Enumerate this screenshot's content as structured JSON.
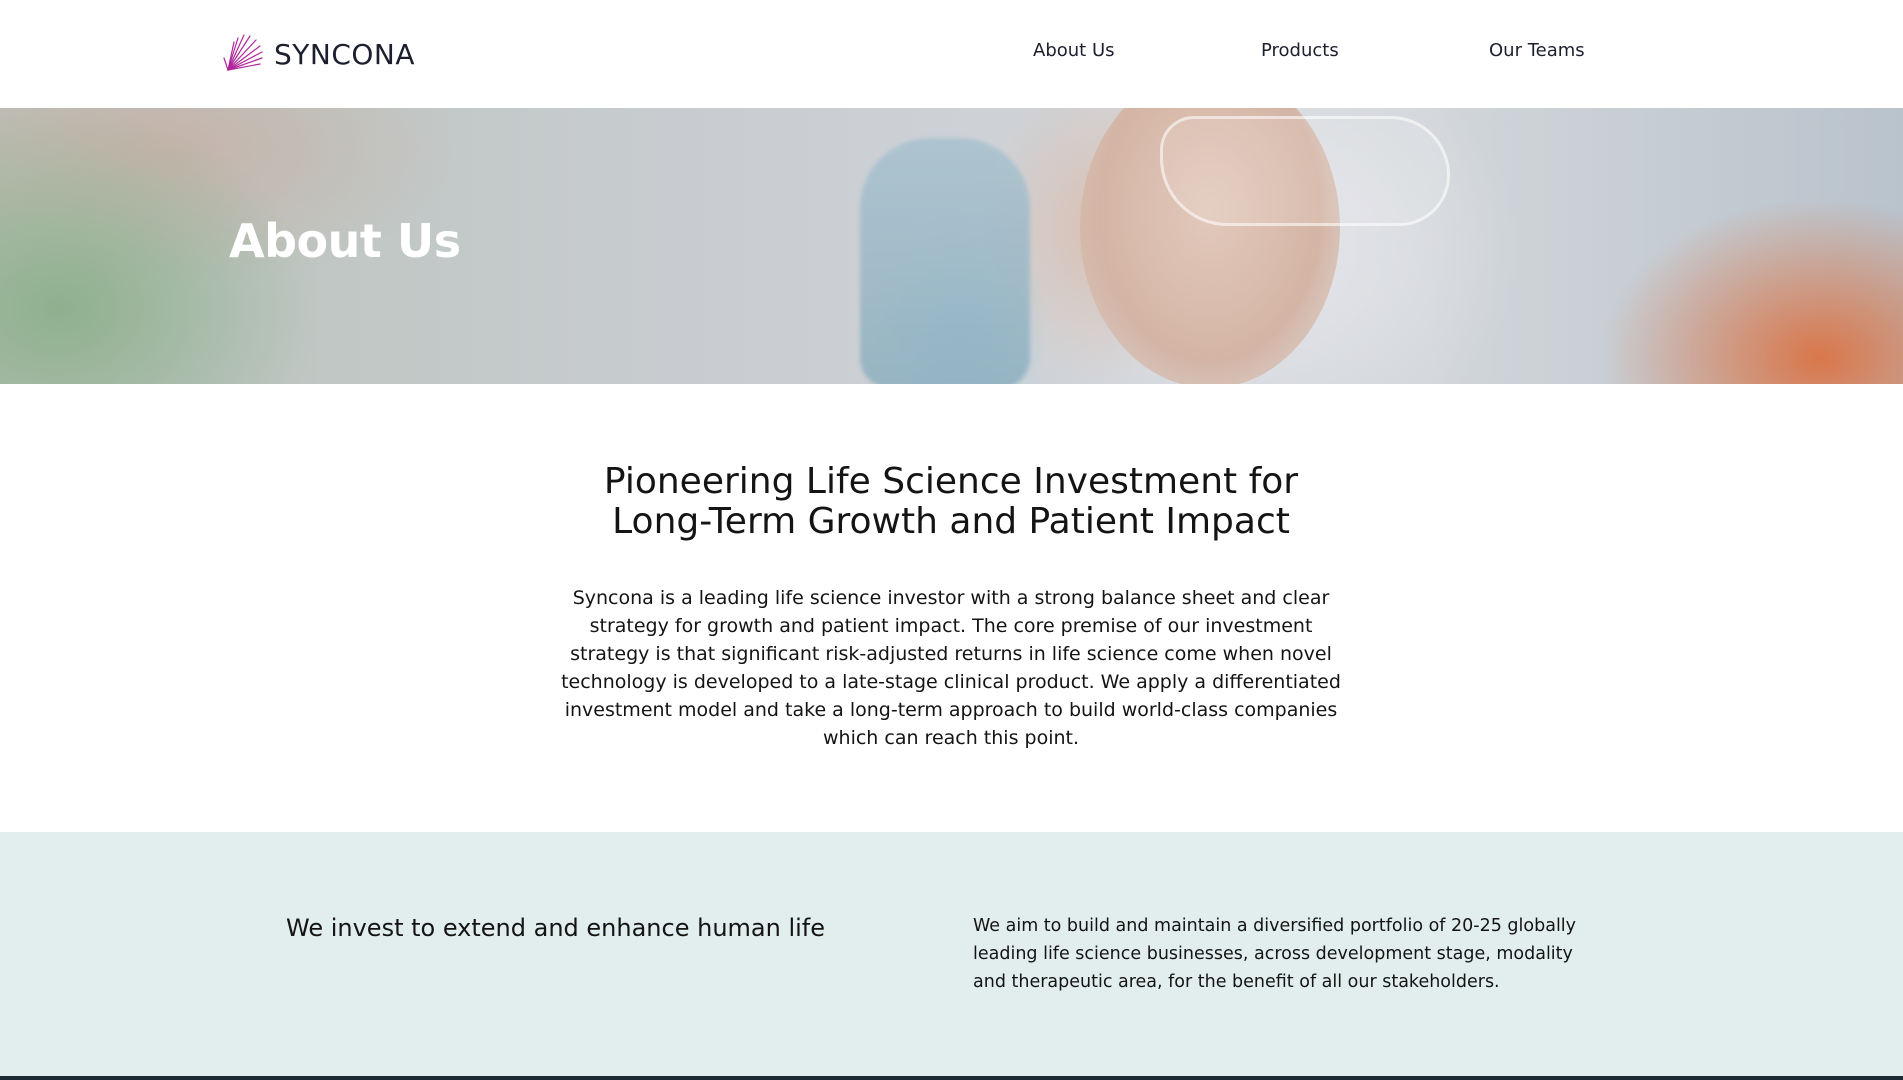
{
  "header": {
    "logo_text": "SYNCONA",
    "nav": [
      {
        "label": "About Us"
      },
      {
        "label": "Products"
      },
      {
        "label": "Our Teams"
      }
    ]
  },
  "hero": {
    "title": "About Us"
  },
  "intro": {
    "heading": "Pioneering Life Science Investment for Long-Term Growth and Patient Impact",
    "body": "Syncona is a leading life science investor with a strong balance sheet and clear strategy for growth and patient impact. The core premise of our investment strategy is that significant risk-adjusted returns in life science come when novel technology is developed to a late-stage clinical product. We apply a differentiated investment model and take a long-term approach to build world-class companies which can reach this point."
  },
  "mission": {
    "heading": "We invest to extend and enhance human life",
    "text": "We aim to build and maintain a diversified portfolio of 20-25 globally leading life science businesses, across development stage, modality and therapeutic area, for the benefit of all our stakeholders."
  },
  "colors": {
    "logo_accent": "#b0269a",
    "band_background": "#e2eeee",
    "footer": "#1b2a33"
  }
}
